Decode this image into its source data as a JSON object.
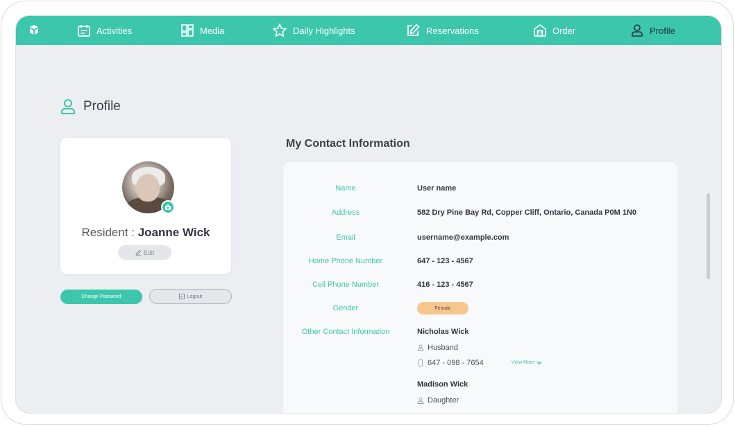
{
  "nav": {
    "items": [
      {
        "label": "Activities",
        "icon": "calendar-icon"
      },
      {
        "label": "Media",
        "icon": "grid-icon"
      },
      {
        "label": "Daily Highlights",
        "icon": "star-icon"
      },
      {
        "label": "Reservations",
        "icon": "edit-square-icon"
      },
      {
        "label": "Order",
        "icon": "store-icon"
      },
      {
        "label": "Profile",
        "icon": "person-icon"
      }
    ],
    "active": "Profile"
  },
  "page": {
    "title": "Profile"
  },
  "profile": {
    "resident_prefix": "Resident : ",
    "resident_name": "Joanne Wick",
    "edit_label": "Edit",
    "change_password_label": "Change Password",
    "logout_label": "Logout"
  },
  "contact": {
    "section_title": "My Contact Information",
    "fields": [
      {
        "label": "Name",
        "value": "User name"
      },
      {
        "label": "Address",
        "value": "582  Dry Pine Bay Rd, Copper Cliff, Ontario, Canada P0M 1N0"
      },
      {
        "label": "Email",
        "value": "username@example.com"
      },
      {
        "label": "Home Phone Number",
        "value": "647 - 123 - 4567"
      },
      {
        "label": "Cell Phone Number",
        "value": "416 - 123 - 4567"
      },
      {
        "label": "Gender",
        "value": "Female"
      },
      {
        "label": "Other Contact Information",
        "value": ""
      }
    ],
    "others": [
      {
        "name": "Nicholas Wick",
        "relation": "Husband",
        "phone": "647 - 098 - 7654",
        "view_more": "View More"
      },
      {
        "name": "Madison Wick",
        "relation": "Daughter"
      }
    ]
  },
  "colors": {
    "accent": "#3cc7ad",
    "background": "#eceef1",
    "gender_pill": "#f7c58e"
  }
}
